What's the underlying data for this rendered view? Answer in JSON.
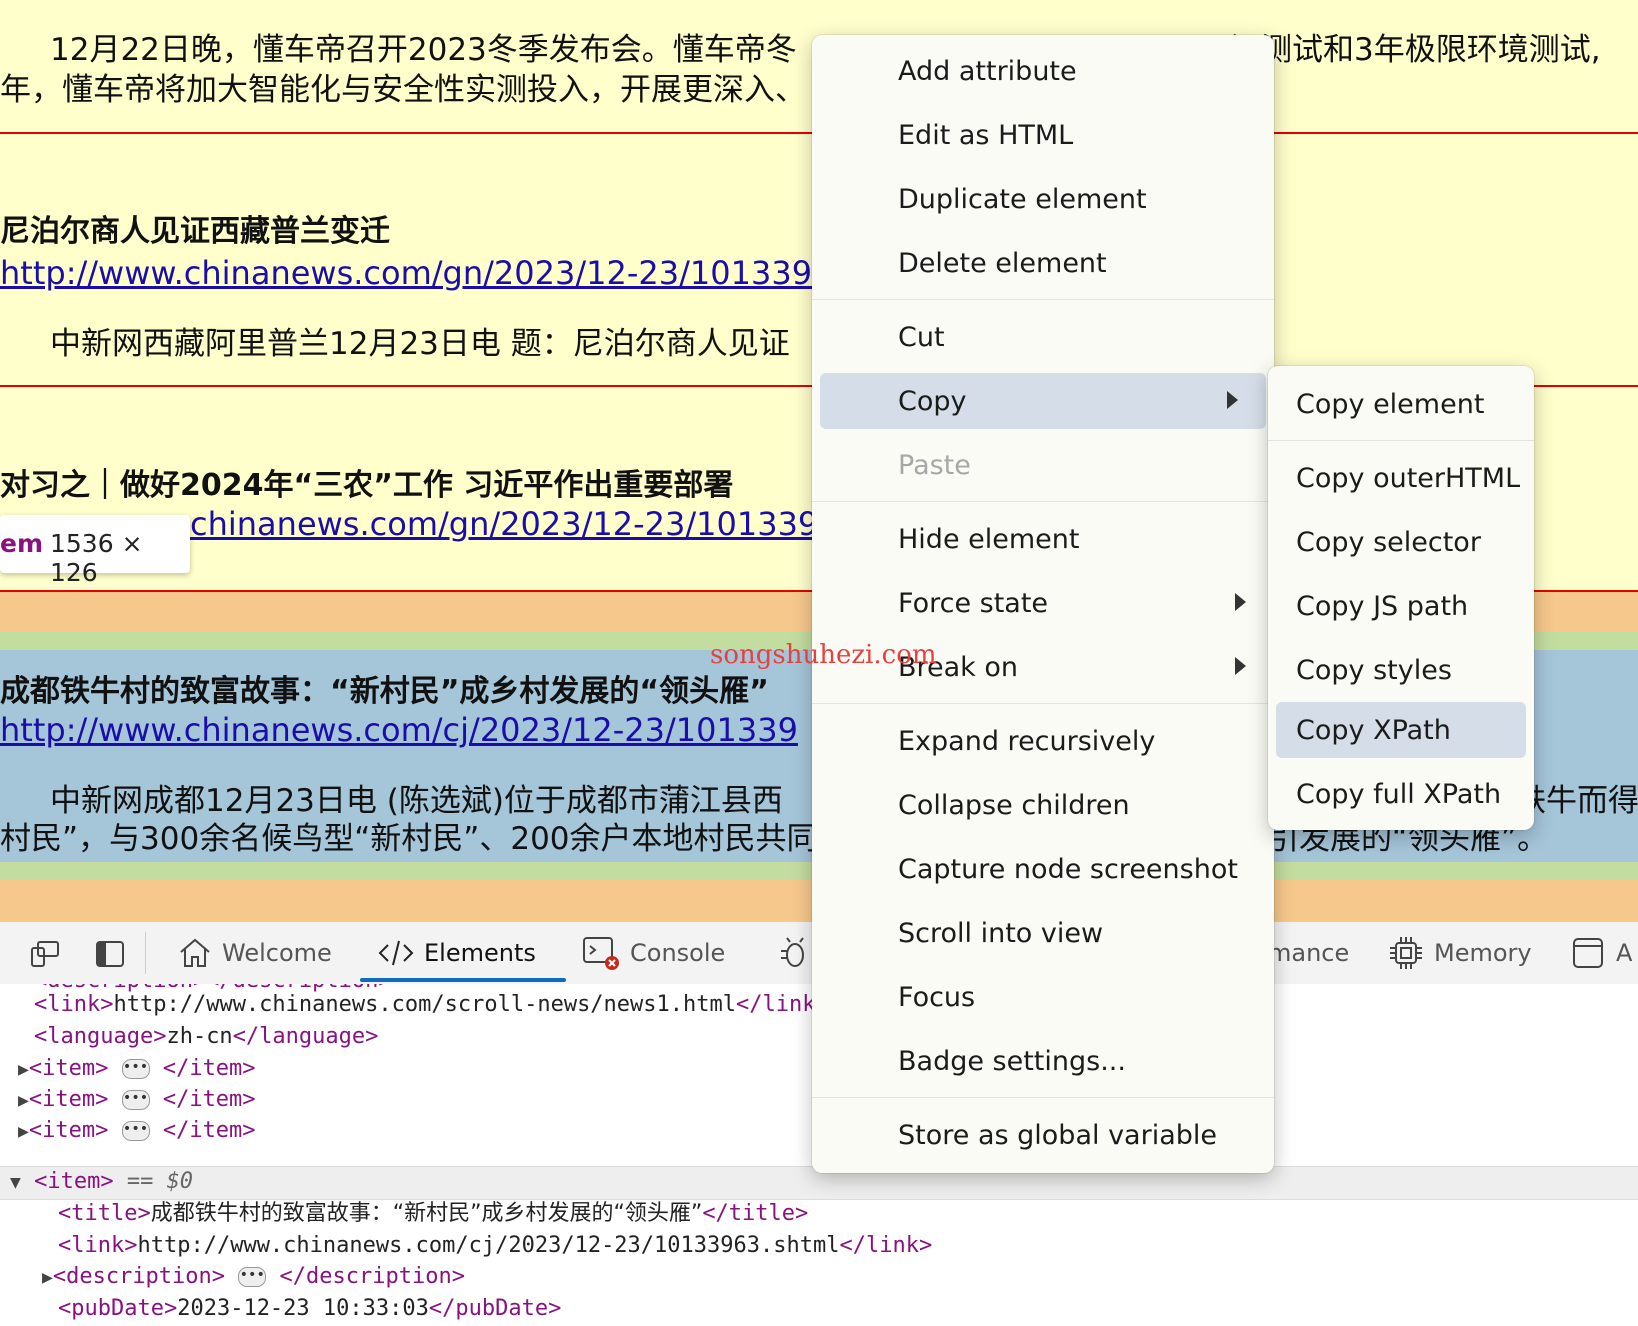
{
  "page": {
    "article1_line1": "12月22日晚，懂车帝召开2023冬季发布会。懂车帝冬",
    "article1_line1_right": "温测试和3年极限环境测试,",
    "article1_line2": "年，懂车帝将加大智能化与安全性实测投入，开展更深入、",
    "article2_title": "尼泊尔商人见证西藏普兰变迁",
    "article2_link": "http://www.chinanews.com/gn/2023/12-23/101339",
    "article2_body": "中新网西藏阿里普兰12月23日电 题：尼泊尔商人见证",
    "article3_title": "对习之｜做好2024年“三农”工作 习近平作出重要部署",
    "article3_link": "chinanews.com/gn/2023/12-23/101339",
    "article4_title": "成都铁牛村的致富故事：“新村民”成乡村发展的“领头雁”",
    "article4_link": "http://www.chinanews.com/cj/2023/12-23/101339",
    "article4_body_line1": "中新网成都12月23日电 (陈选斌)位于成都市蒲江县西",
    "article4_body_line1_right": "铁牛而得",
    "article4_body_line2": "村民”，与300余名候鸟型“新村民”、200余户本地村民共同",
    "article4_body_line2_right": "引发展的“领头雁”。",
    "tooltip_tag": "em",
    "tooltip_dims": "1536 × 126",
    "watermark": "songshuhezi.com"
  },
  "devtools": {
    "tabs": {
      "welcome": "Welcome",
      "elements": "Elements",
      "console": "Console",
      "performance_partial": "mance",
      "memory": "Memory",
      "application_partial": "A"
    },
    "dom": {
      "line_desc_top": "<description></description>",
      "line_link_open": "<link>",
      "line_link_text": "http://www.chinanews.com/scroll-news/news1.html",
      "line_link_close": "</link",
      "line_lang_open": "<language>",
      "line_lang_text": "zh-cn",
      "line_lang_close": "</language>",
      "item_open": "<item>",
      "item_close": "</item>",
      "ellipsis": "•••",
      "selected_suffix": "== $0",
      "title_open": "<title>",
      "title_text": "成都铁牛村的致富故事：“新村民”成乡村发展的“领头雁”",
      "title_close": "</title>",
      "link_open": "<link>",
      "link_text": "http://www.chinanews.com/cj/2023/12-23/10133963.shtml",
      "link_close": "</link>",
      "desc_open": "<description>",
      "desc_close": "</description>",
      "pub_open": "<pubDate>",
      "pub_text": "2023-12-23 10:33:03",
      "pub_close": "</pubDate>"
    }
  },
  "context_menu": {
    "items": [
      "Add attribute",
      "Edit as HTML",
      "Duplicate element",
      "Delete element",
      "Cut",
      "Copy",
      "Paste",
      "Hide element",
      "Force state",
      "Break on",
      "Expand recursively",
      "Collapse children",
      "Capture node screenshot",
      "Scroll into view",
      "Focus",
      "Badge settings...",
      "Store as global variable"
    ]
  },
  "copy_submenu": {
    "items": [
      "Copy element",
      "Copy outerHTML",
      "Copy selector",
      "Copy JS path",
      "Copy styles",
      "Copy XPath",
      "Copy full XPath"
    ]
  },
  "colors": {
    "page_bg": "#ffffcc",
    "rule_red": "#e60000",
    "margin_orange": "#f6c88c",
    "padding_green": "#c3dca0",
    "content_blue": "#a5c5d9",
    "link_blue": "#1a0dab",
    "tag_purple": "#881280",
    "accent_blue": "#0f6cbd"
  }
}
